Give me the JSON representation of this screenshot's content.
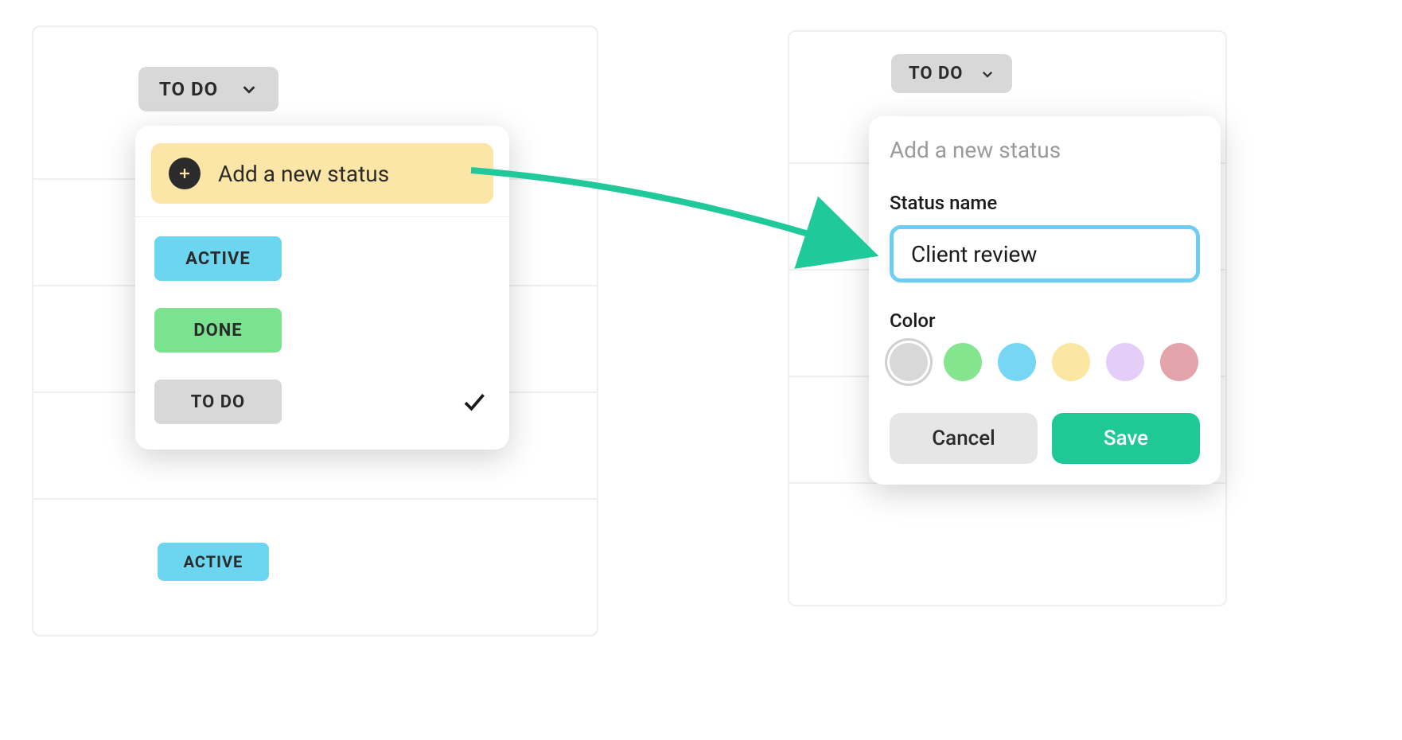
{
  "left": {
    "current_status": "TO DO",
    "add_label": "Add a new status",
    "options": [
      {
        "label": "ACTIVE",
        "color": "#6cd6f0",
        "selected": false
      },
      {
        "label": "DONE",
        "color": "#7be38f",
        "selected": false
      },
      {
        "label": "TO DO",
        "color": "#d8d8d8",
        "selected": true
      }
    ],
    "below_badge": {
      "label": "ACTIVE",
      "color": "#6cd6f0"
    }
  },
  "right": {
    "current_status": "TO DO",
    "form_title": "Add a new status",
    "name_label": "Status name",
    "name_value": "Client review",
    "color_label": "Color",
    "colors": [
      {
        "hex": "#d8d8d8",
        "selected": true
      },
      {
        "hex": "#85e58f"
      },
      {
        "hex": "#76d7f5"
      },
      {
        "hex": "#fbe6a2"
      },
      {
        "hex": "#e4cdf9"
      },
      {
        "hex": "#e2a3aa"
      }
    ],
    "cancel": "Cancel",
    "save": "Save"
  },
  "arrow_color": "#1fc99a"
}
